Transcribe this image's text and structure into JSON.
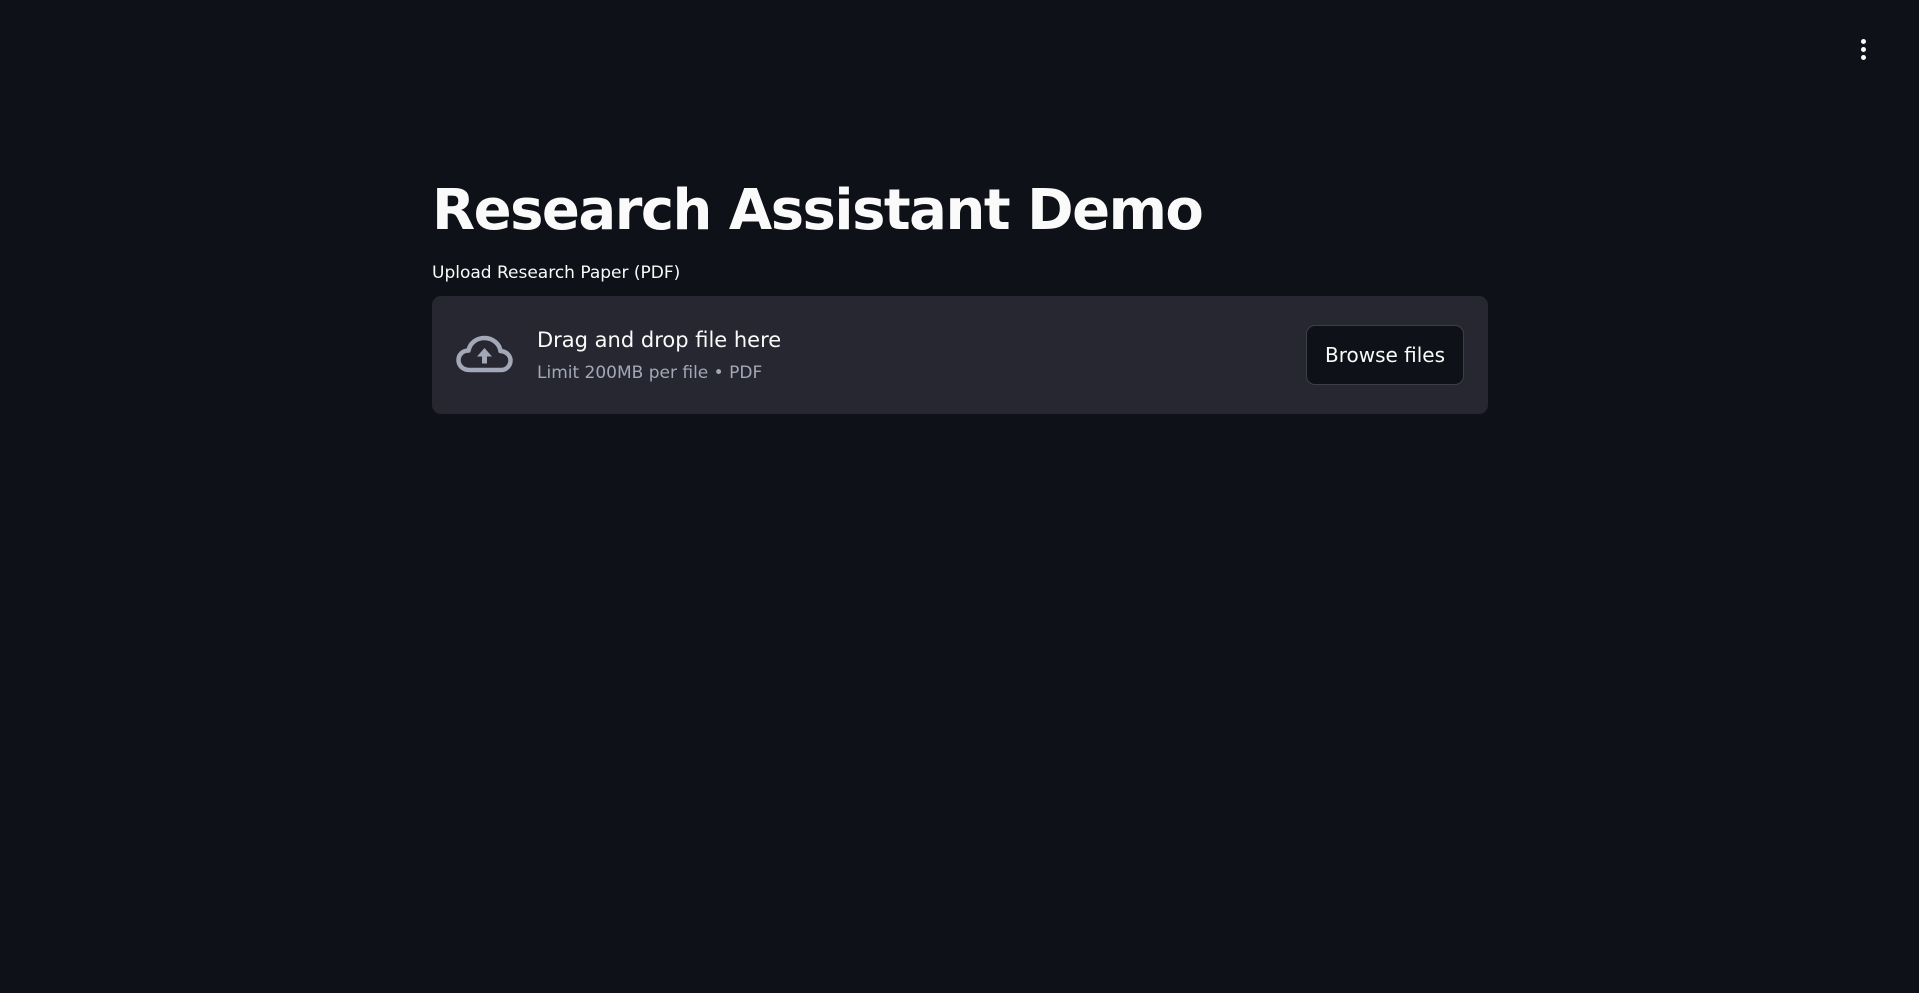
{
  "header": {
    "menu_icon": "kebab-menu-icon"
  },
  "main": {
    "title": "Research Assistant Demo",
    "uploader": {
      "label": "Upload Research Paper (PDF)",
      "icon": "cloud-upload-icon",
      "instruction": "Drag and drop file here",
      "limits": "Limit 200MB per file • PDF",
      "browse_label": "Browse files"
    }
  },
  "colors": {
    "background": "#0e1117",
    "dropzone": "#262730",
    "text": "#fafafa",
    "muted_text": "#a3a8b8"
  }
}
